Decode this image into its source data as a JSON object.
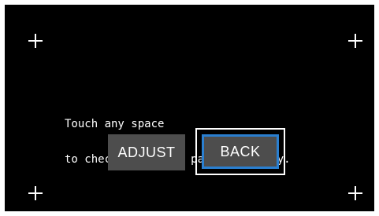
{
  "calibration": {
    "message_line1": "Touch any space",
    "message_line2": "to check the touch panel accuracy.",
    "markers": [
      "crosshair-icon",
      "crosshair-icon",
      "crosshair-icon",
      "crosshair-icon"
    ]
  },
  "buttons": {
    "adjust_label": "ADJUST",
    "back_label": "BACK"
  },
  "colors": {
    "screen_background": "#000000",
    "button_fill": "#4d4d4d",
    "focus_border": "#2a7fd0",
    "text": "#ffffff"
  }
}
